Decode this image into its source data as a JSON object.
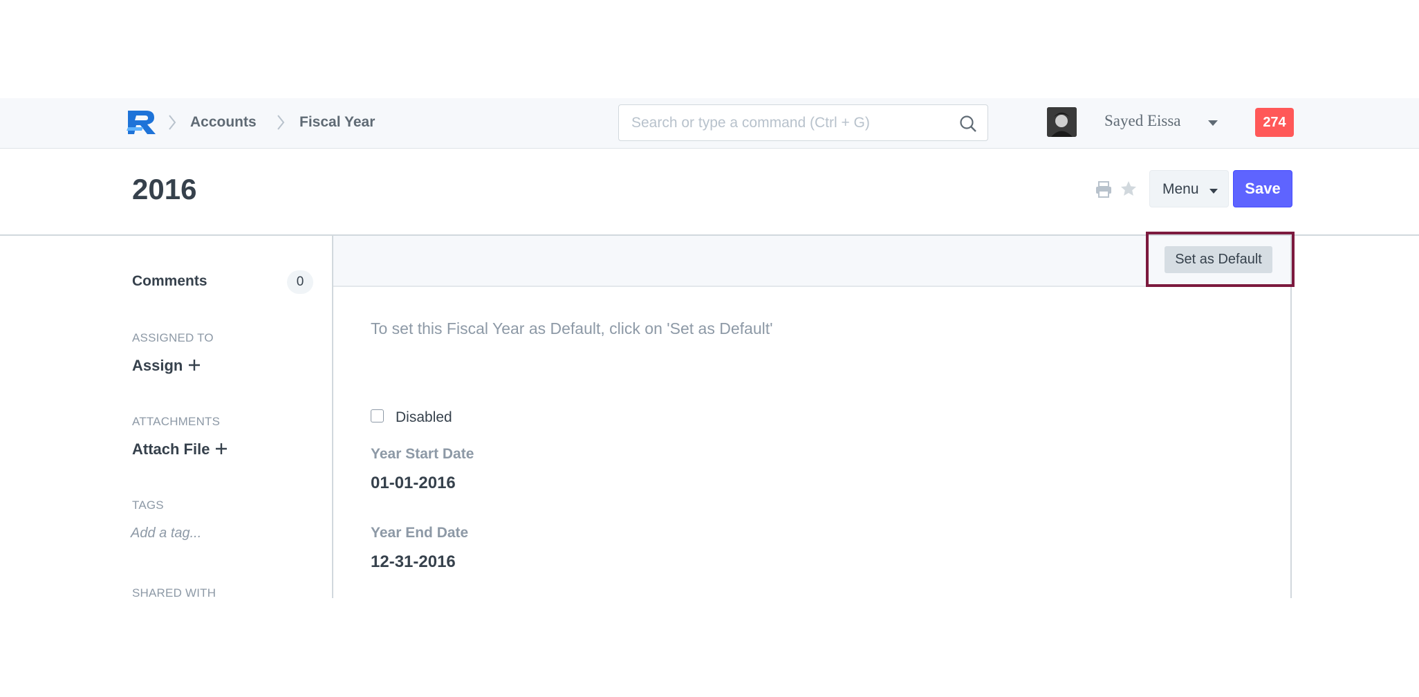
{
  "navbar": {
    "breadcrumbs": [
      "Accounts",
      "Fiscal Year"
    ],
    "search_placeholder": "Search or type a command (Ctrl + G)",
    "user_name": "Sayed Eissa",
    "notification_count": "274"
  },
  "page": {
    "title": "2016",
    "menu_label": "Menu",
    "save_label": "Save"
  },
  "sidebar": {
    "comments_label": "Comments",
    "comments_count": "0",
    "assigned_heading": "ASSIGNED TO",
    "assign_label": "Assign",
    "attachments_heading": "ATTACHMENTS",
    "attach_label": "Attach File",
    "tags_heading": "TAGS",
    "tag_placeholder": "Add a tag...",
    "shared_heading": "SHARED WITH"
  },
  "form": {
    "set_default_label": "Set as Default",
    "help_text": "To set this Fiscal Year as Default, click on 'Set as Default'",
    "disabled_label": "Disabled",
    "disabled_checked": false,
    "start_label": "Year Start Date",
    "start_value": "01-01-2016",
    "end_label": "Year End Date",
    "end_value": "12-31-2016"
  },
  "colors": {
    "primary": "#5e64ff",
    "notification": "#ff5858",
    "highlight": "#7c1a3e"
  }
}
